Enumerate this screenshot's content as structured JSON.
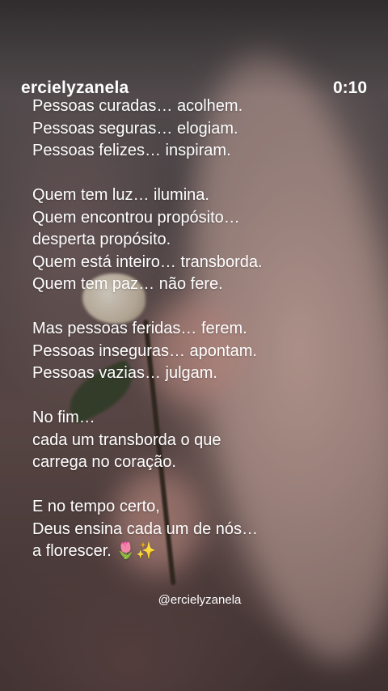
{
  "header": {
    "username": "ercielyzanela",
    "timer": "0:10"
  },
  "poem": {
    "lines": [
      "Pessoas curadas… acolhem.",
      "Pessoas seguras… elogiam.",
      "Pessoas felizes… inspiram.",
      "",
      "Quem tem luz… ilumina.",
      "Quem encontrou propósito…",
      "desperta propósito.",
      "Quem está inteiro… transborda.",
      "Quem tem paz… não fere.",
      "",
      "Mas pessoas feridas… ferem.",
      "Pessoas inseguras… apontam.",
      "Pessoas vazias… julgam.",
      "",
      "No fim…",
      "cada um transborda o que",
      "carrega no coração.",
      "",
      "E no tempo certo,",
      "Deus ensina cada um de nós…",
      "a florescer. 🌷✨"
    ]
  },
  "watermark": "@ercielyzanela"
}
